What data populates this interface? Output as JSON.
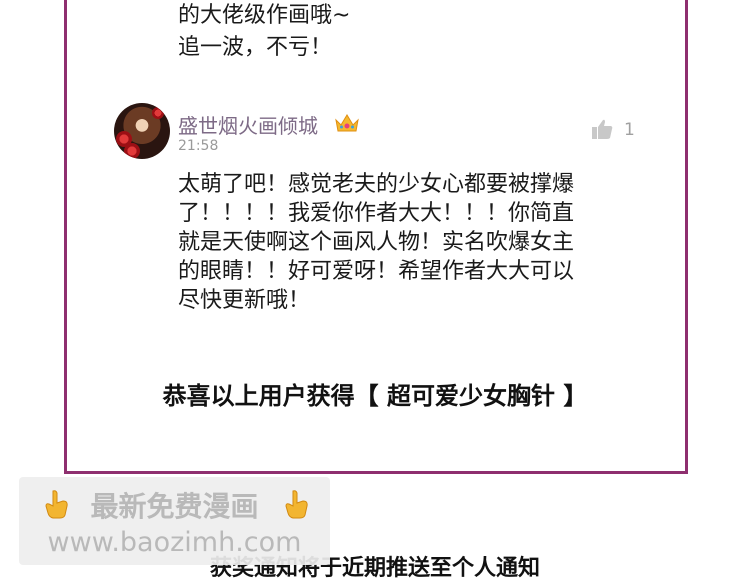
{
  "previous_comment": {
    "line1": "的大佬级作画哦~",
    "line2": "追一波，不亏！"
  },
  "comment": {
    "username": "盛世烟火画倾城",
    "timestamp": "21:58",
    "like_count": "1",
    "lines": [
      "太萌了吧！感觉老夫的少女心都要被撑爆",
      "了！！！！我爱你作者大大！！！你简直",
      "就是天使啊这个画风人物！实名吹爆女主",
      "的眼睛！！好可爱呀！希望作者大大可以",
      "尽快更新哦！"
    ],
    "badge_icon": "crown-icon"
  },
  "congrats": "恭喜以上用户获得【 超可爱少女胸针 】",
  "watermark": {
    "line1": "最新免费漫画",
    "line2": "www.baozimh.com"
  },
  "notice": "获奖通知将于近期推送至个人通知",
  "colors": {
    "frame": "#8e2f6f",
    "username": "#7d6a86",
    "timestamp": "#9a9a9a"
  }
}
